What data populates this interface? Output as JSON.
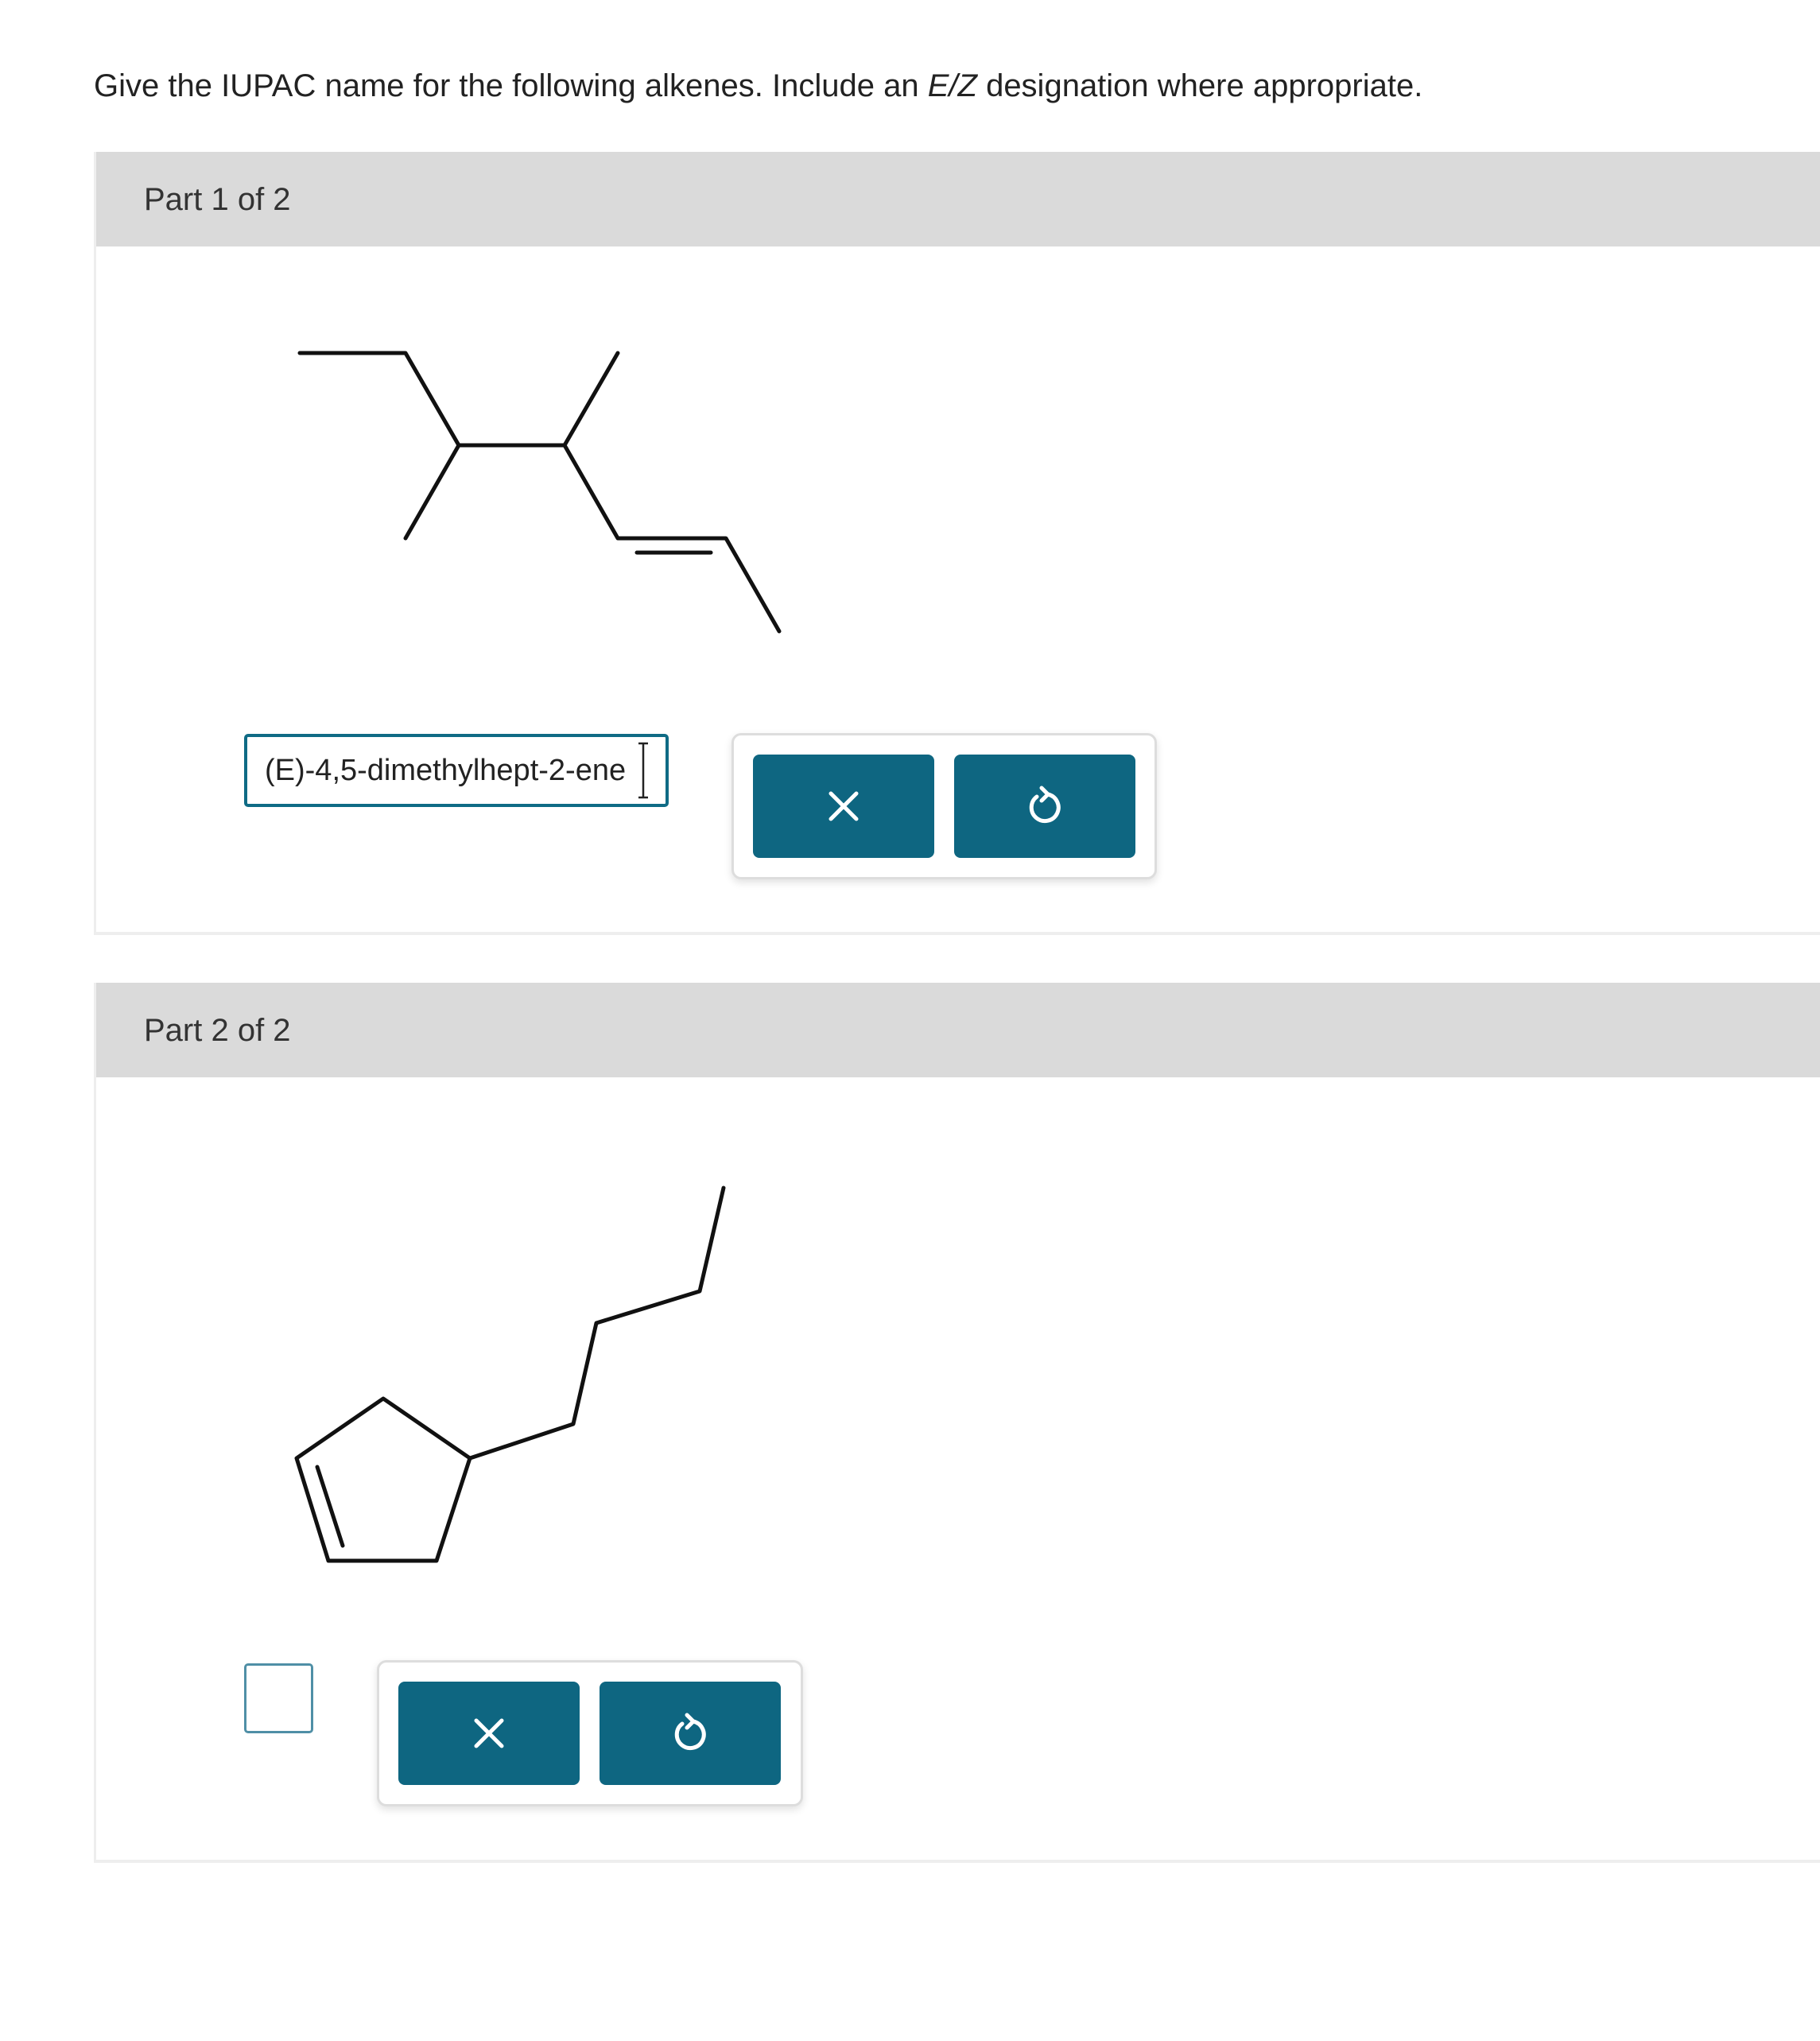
{
  "prompt": {
    "before": "Give the IUPAC name for the following alkenes. Include an ",
    "italic": "E/Z",
    "after": " designation where appropriate."
  },
  "parts": [
    {
      "header": "Part 1 of 2",
      "answer_value": "(E)-4,5-dimethylhept-2-ene",
      "answer_placeholder": "",
      "buttons": [
        {
          "icon": "close-icon"
        },
        {
          "icon": "reset-icon"
        }
      ]
    },
    {
      "header": "Part 2 of 2",
      "answer_value": "",
      "answer_placeholder": "",
      "buttons": [
        {
          "icon": "close-icon"
        },
        {
          "icon": "reset-icon"
        }
      ]
    }
  ],
  "colors": {
    "button": "#0e6681",
    "input_border": "#0f6b85",
    "header_bg": "#dadada"
  }
}
